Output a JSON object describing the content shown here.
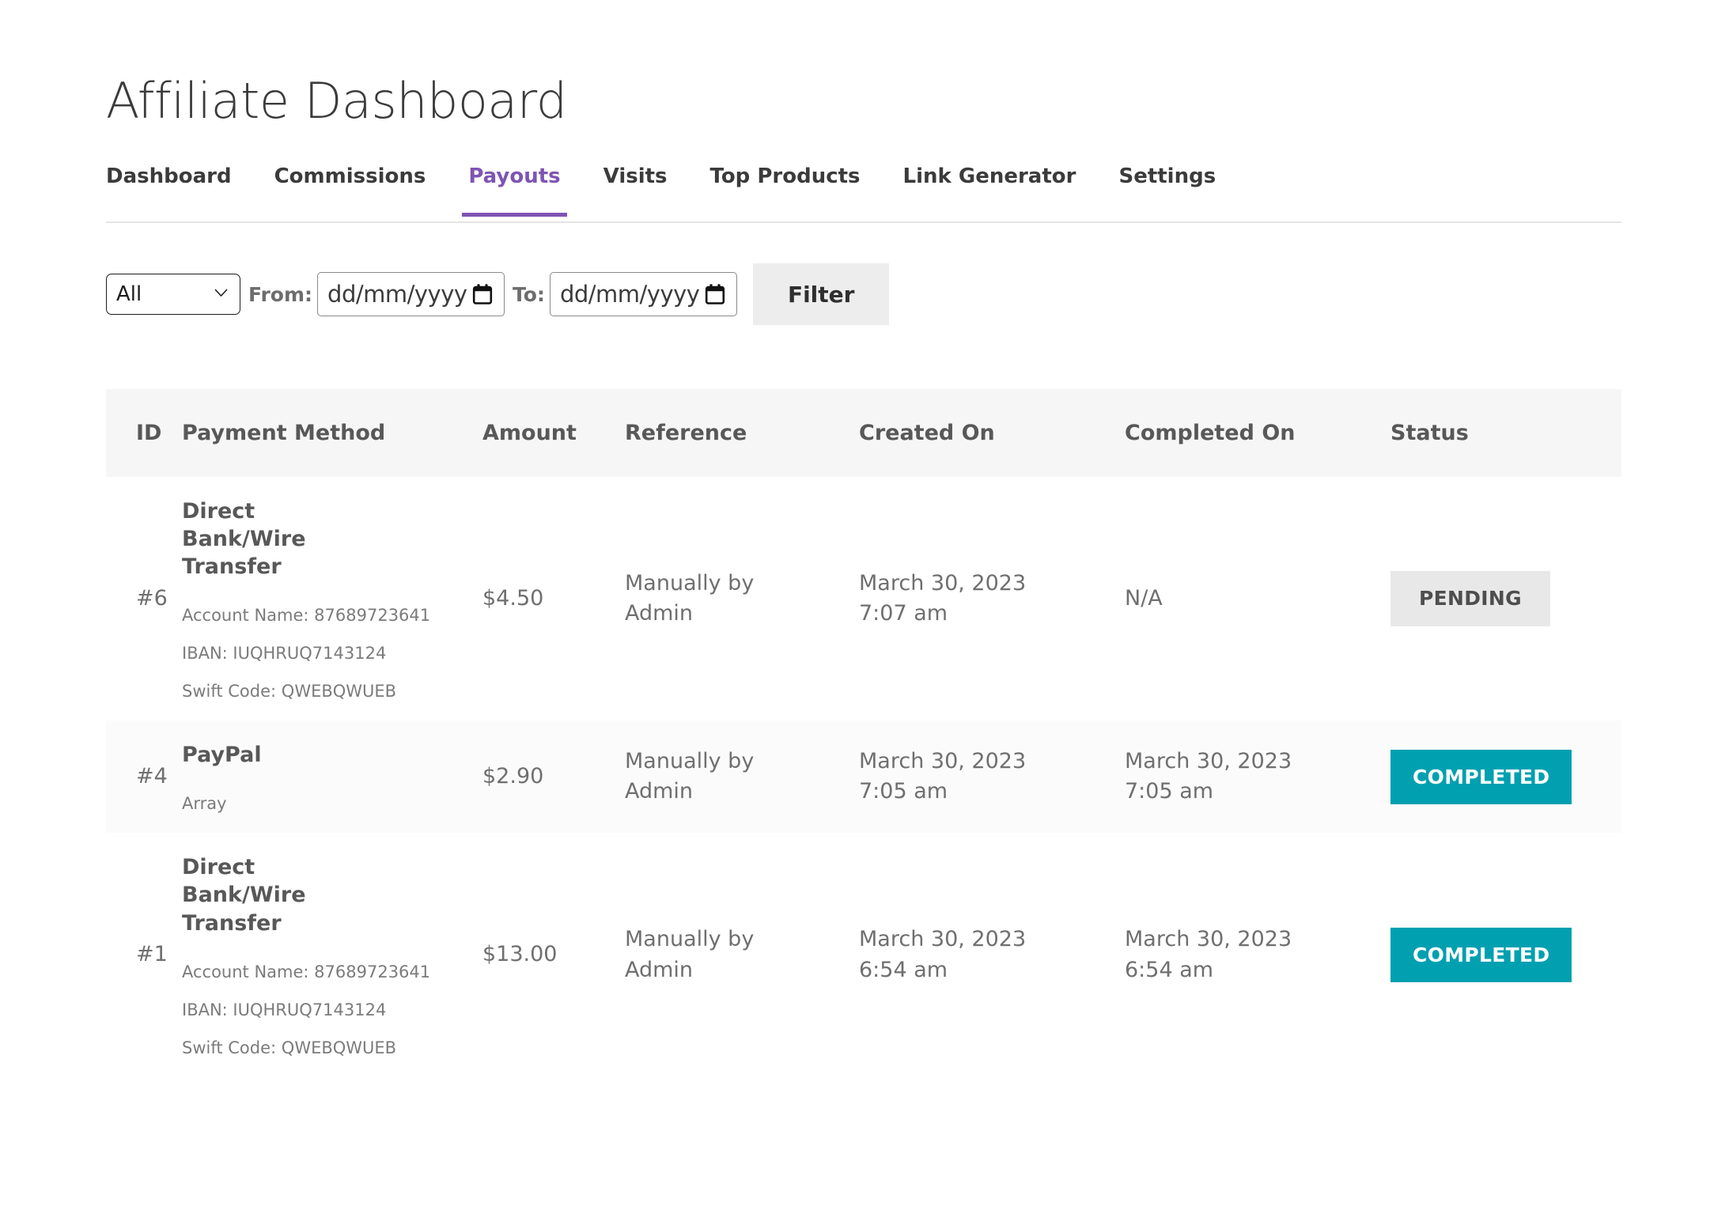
{
  "header": {
    "title": "Affiliate Dashboard"
  },
  "tabs": [
    {
      "label": "Dashboard",
      "active": false
    },
    {
      "label": "Commissions",
      "active": false
    },
    {
      "label": "Payouts",
      "active": true
    },
    {
      "label": "Visits",
      "active": false
    },
    {
      "label": "Top Products",
      "active": false
    },
    {
      "label": "Link Generator",
      "active": false
    },
    {
      "label": "Settings",
      "active": false
    }
  ],
  "filter_bar": {
    "status_select": {
      "selected": "All",
      "options": [
        "All"
      ]
    },
    "from_label": "From:",
    "from_value": "",
    "from_placeholder": "dd/mm/yyyy",
    "to_label": "To:",
    "to_value": "",
    "to_placeholder": "dd/mm/yyyy",
    "filter_button": "Filter"
  },
  "table": {
    "columns": [
      "ID",
      "Payment Method",
      "Amount",
      "Reference",
      "Created On",
      "Completed On",
      "Status"
    ],
    "rows": [
      {
        "id": "#6",
        "method_title": "Direct Bank/Wire Transfer",
        "method_details": [
          "Account Name: 87689723641",
          "IBAN: IUQHRUQ7143124",
          "Swift Code: QWEBQWUEB"
        ],
        "amount": "$4.50",
        "reference": "Manually by Admin",
        "created_on": "March 30, 2023 7:07 am",
        "completed_on": "N/A",
        "status": "PENDING",
        "status_kind": "pending"
      },
      {
        "id": "#4",
        "method_title": "PayPal",
        "method_details": [
          "Array"
        ],
        "amount": "$2.90",
        "reference": "Manually by Admin",
        "created_on": "March 30, 2023 7:05 am",
        "completed_on": "March 30, 2023 7:05 am",
        "status": "COMPLETED",
        "status_kind": "completed"
      },
      {
        "id": "#1",
        "method_title": "Direct Bank/Wire Transfer",
        "method_details": [
          "Account Name: 87689723641",
          "IBAN: IUQHRUQ7143124",
          "Swift Code: QWEBQWUEB"
        ],
        "amount": "$13.00",
        "reference": "Manually by Admin",
        "created_on": "March 30, 2023 6:54 am",
        "completed_on": "March 30, 2023 6:54 am",
        "status": "COMPLETED",
        "status_kind": "completed"
      }
    ]
  },
  "colors": {
    "accent_purple": "#7f54b3",
    "status_completed": "#00a0b0",
    "status_pending_bg": "#e8e8e8",
    "header_row_bg": "#f6f6f6",
    "alt_row_bg": "#fbfbfb"
  }
}
